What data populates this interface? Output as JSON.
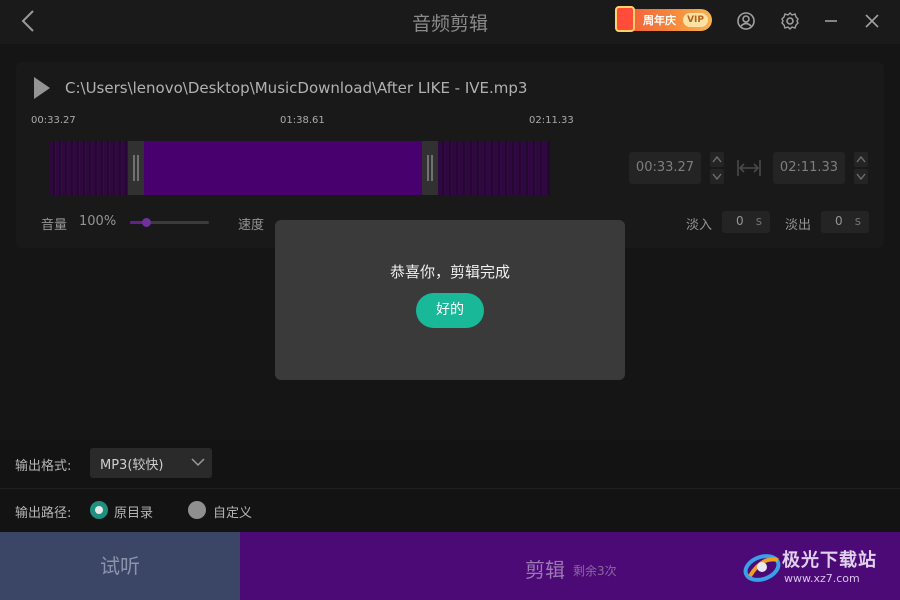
{
  "header": {
    "title": "音频剪辑",
    "promo_text": "周年庆",
    "promo_vip": "VIP",
    "icons": [
      "back-icon",
      "user-icon",
      "gear-icon",
      "minimize-icon",
      "close-icon"
    ]
  },
  "file": {
    "path": "C:\\Users\\lenovo\\Desktop\\MusicDownload\\After LIKE - IVE.mp3",
    "marks": [
      "00:33.27",
      "01:38.61",
      "02:11.33"
    ],
    "start_time": "00:33.27",
    "end_time": "02:11.33"
  },
  "controls": {
    "volume_label": "音量",
    "volume_value": "100%",
    "volume_level": 0.2,
    "speed_label": "速度",
    "fade_in_label": "淡入",
    "fade_in_value": "0",
    "fade_out_label": "淡出",
    "fade_out_value": "0",
    "fade_unit": "s"
  },
  "output": {
    "format_label": "输出格式:",
    "format_value": "MP3(较快)",
    "path_label": "输出路径:",
    "option_original": "原目录",
    "option_custom": "自定义"
  },
  "actions": {
    "preview": "试听",
    "cut": "剪辑",
    "cut_remaining": "剩余3次"
  },
  "dialog": {
    "message": "恭喜你，剪辑完成",
    "ok": "好的"
  },
  "watermark": {
    "text": "极光下载站",
    "url": "www.xz7.com"
  },
  "colors": {
    "accent_purple": "#5a0088",
    "ok_green": "#19b899",
    "cut_button": "#4c0a77",
    "preview_button": "#3b4566"
  }
}
